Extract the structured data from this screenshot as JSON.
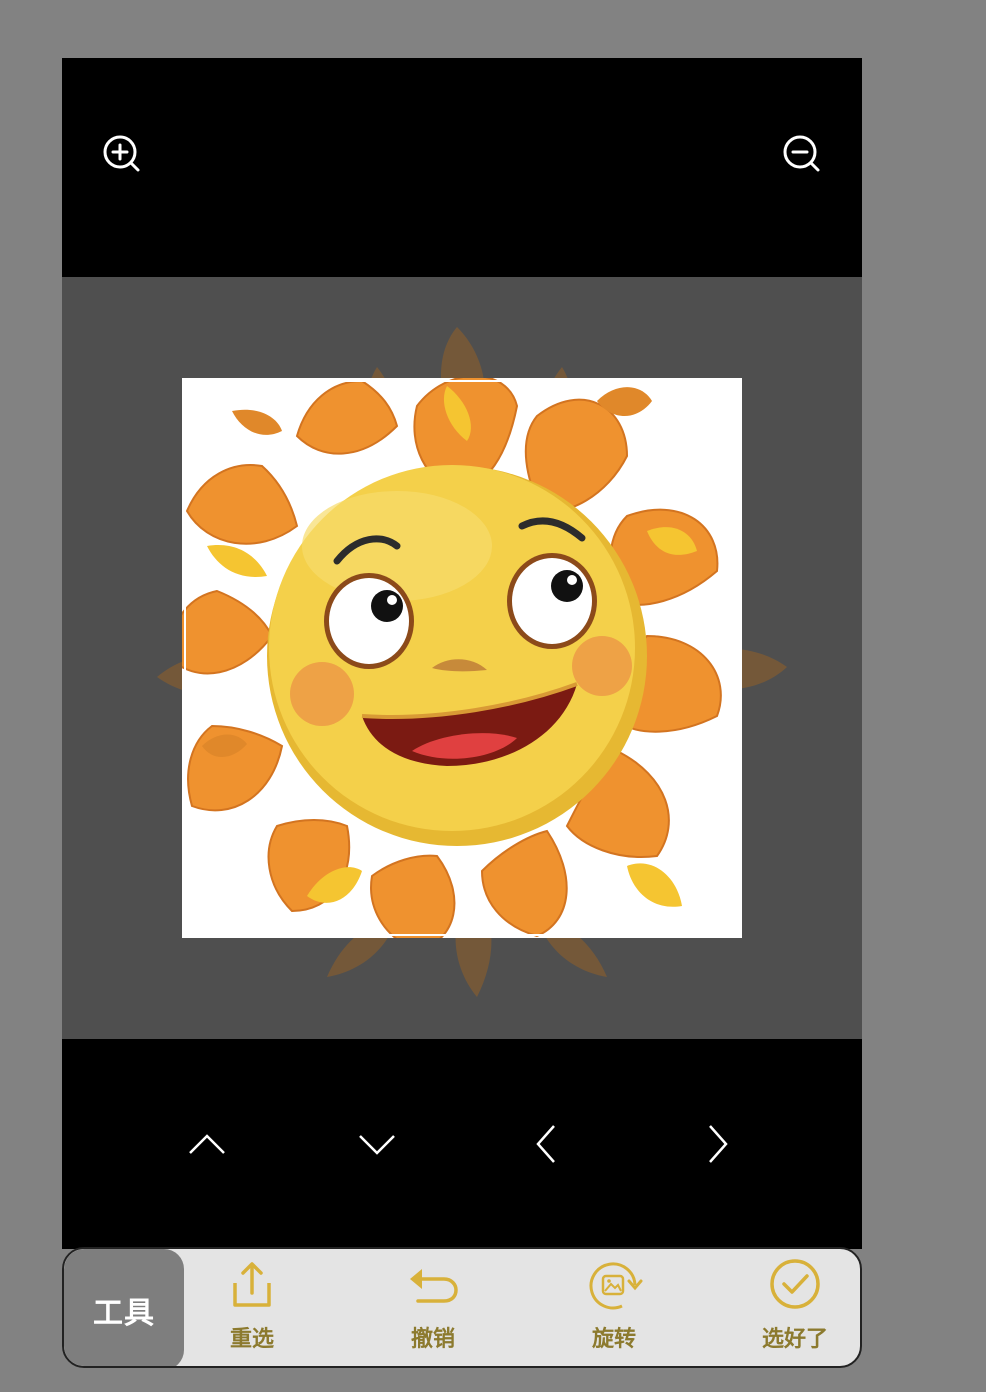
{
  "top_bar": {
    "zoom_in_icon": "zoom-in-icon",
    "zoom_out_icon": "zoom-out-icon"
  },
  "arrows": [
    {
      "name": "up",
      "icon": "chevron-up-icon"
    },
    {
      "name": "down",
      "icon": "chevron-down-icon"
    },
    {
      "name": "left",
      "icon": "chevron-left-icon"
    },
    {
      "name": "right",
      "icon": "chevron-right-icon"
    }
  ],
  "toolbar": {
    "tools_label": "工具",
    "reselect_label": "重选",
    "undo_label": "撤销",
    "rotate_label": "旋转",
    "done_label": "选好了"
  },
  "colors": {
    "accent": "#d8b13a",
    "label": "#8c7a2e",
    "toolbar_bg": "#e4e4e4",
    "tools_tab_bg": "#7e7e7e"
  }
}
